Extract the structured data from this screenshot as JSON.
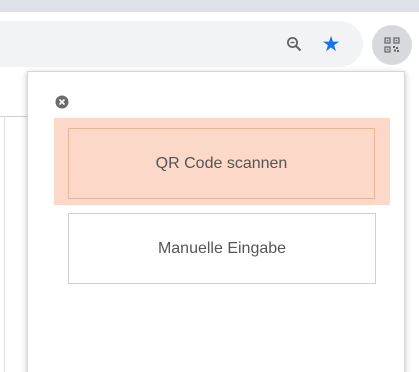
{
  "colors": {
    "accent": "#fbd8c7",
    "accent_border": "#e9b49a",
    "star": "#1a73e8",
    "page_marker": "#e0403a"
  },
  "browser": {
    "zoom_icon": "magnifier-zoom-icon",
    "bookmark_icon": "star-filled-icon",
    "extension_icon": "qr-code-icon"
  },
  "popup": {
    "close_icon": "close-circle-icon",
    "scan_label": "QR Code scannen",
    "manual_label": "Manuelle Eingabe"
  }
}
